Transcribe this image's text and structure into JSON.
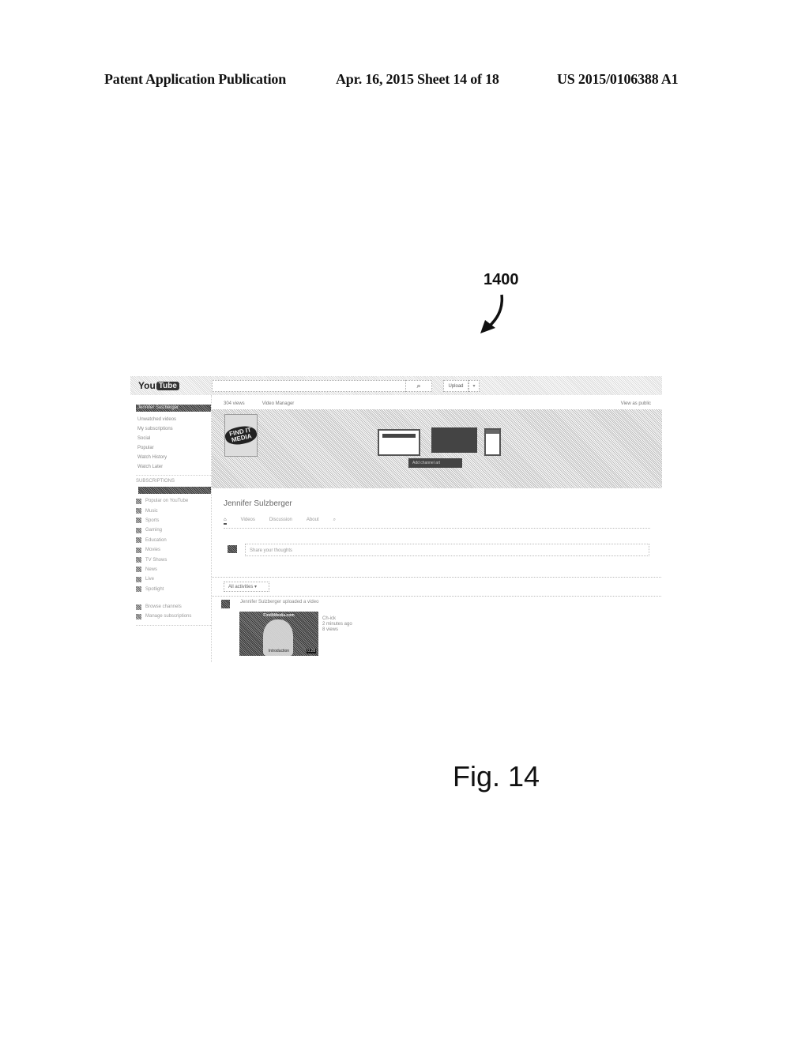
{
  "header": {
    "left": "Patent Application Publication",
    "center": "Apr. 16, 2015  Sheet 14 of 18",
    "right": "US 2015/0106388 A1"
  },
  "reference_numeral": "1400",
  "figure_label": "Fig. 14",
  "screenshot": {
    "topbar": {
      "logo_you": "You",
      "logo_tube": "Tube",
      "search_placeholder": "",
      "upload_label": "Upload",
      "upload_caret": "▾"
    },
    "sidebar": {
      "active_user": "Jennifer Sulzberger",
      "items": [
        "Unwatched videos",
        "My subscriptions",
        "Social",
        "Popular",
        "Watch History",
        "Watch Later"
      ],
      "heading": "SUBSCRIPTIONS",
      "categories": [
        "Popular on YouTube",
        "Music",
        "Sports",
        "Gaming",
        "Education",
        "Movies",
        "TV Shows",
        "News",
        "Live",
        "Spotlight"
      ],
      "footer_items": [
        "Browse channels",
        "Manage subscriptions"
      ]
    },
    "channel": {
      "stats_views": "304 views",
      "video_manager": "Video Manager",
      "view_as_public": "View as public",
      "avatar_text": "FIND IT MEDIA",
      "banner_button": "Add channel art",
      "name": "Jennifer Sulzberger",
      "tabs": [
        "Home",
        "Videos",
        "Discussion",
        "About"
      ],
      "search_tab_icon": "search-icon",
      "share_placeholder": "Share your thoughts",
      "activity_filter": "All activities",
      "feed": {
        "text": "Jennifer Sulzberger uploaded a video",
        "thumb_title": "FindItMedia.com",
        "thumb_subtitle": "Introduction",
        "duration": "0:28",
        "meta": [
          "Ch-ick",
          "2 minutes ago",
          "8 views"
        ]
      }
    }
  }
}
